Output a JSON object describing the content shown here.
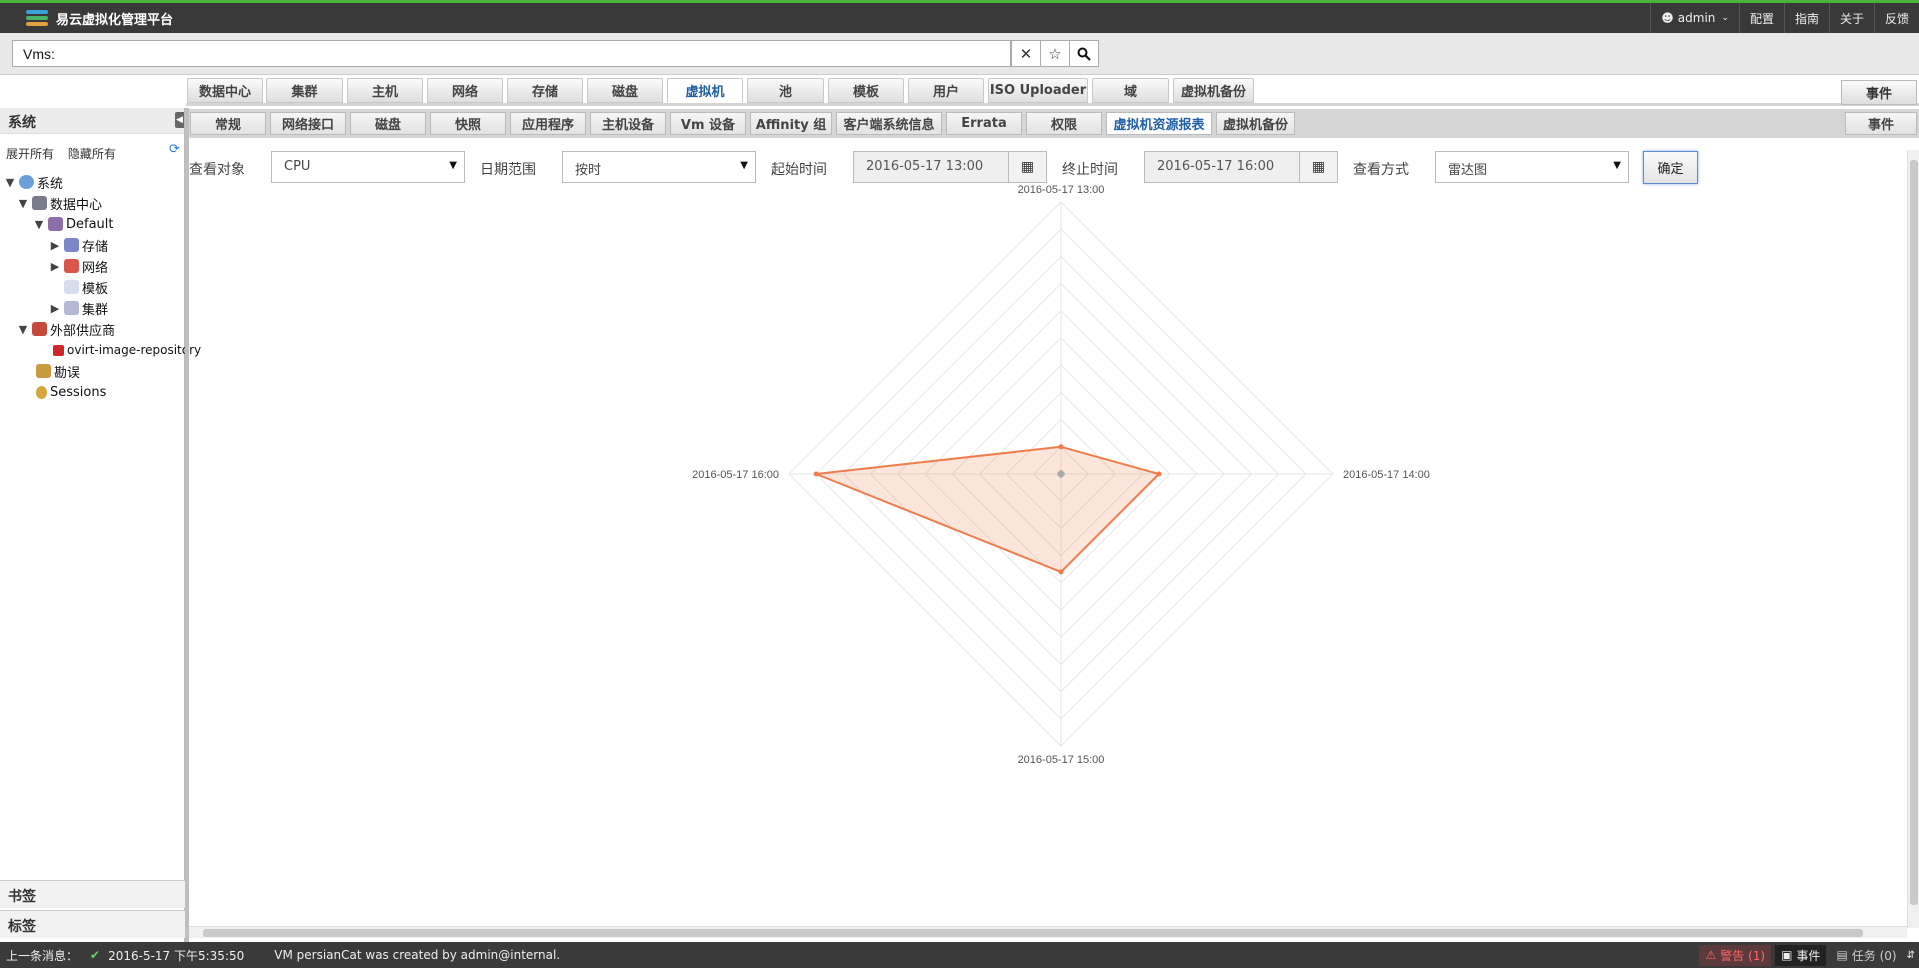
{
  "header": {
    "app_title": "易云虚拟化管理平台",
    "user": "admin",
    "menu": [
      "配置",
      "指南",
      "关于",
      "反馈"
    ]
  },
  "search": {
    "value": "Vms:"
  },
  "main_tabs": [
    "数据中心",
    "集群",
    "主机",
    "网络",
    "存储",
    "磁盘",
    "虚拟机",
    "池",
    "模板",
    "用户",
    "ISO Uploader",
    "域",
    "虚拟机备份"
  ],
  "main_tabs_active": "虚拟机",
  "events_label": "事件",
  "sub_tabs": [
    "常规",
    "网络接口",
    "磁盘",
    "快照",
    "应用程序",
    "主机设备",
    "Vm 设备",
    "Affinity 组",
    "客户端系统信息",
    "Errata",
    "权限",
    "虚拟机资源报表",
    "虚拟机备份"
  ],
  "sub_tabs_active": "虚拟机资源报表",
  "sidebar": {
    "title": "系统",
    "expand_all": "展开所有",
    "collapse_all": "隐藏所有",
    "tree": [
      "系统",
      "数据中心",
      "Default",
      "存储",
      "网络",
      "模板",
      "集群",
      "外部供应商",
      "ovirt-image-repository",
      "勘误",
      "Sessions"
    ],
    "bookmarks": "书签",
    "tags": "标签"
  },
  "filters": {
    "object_label": "查看对象",
    "object_value": "CPU",
    "range_label": "日期范围",
    "range_value": "按时",
    "start_label": "起始时间",
    "start_value": "2016-05-17 13:00",
    "end_label": "终止时间",
    "end_value": "2016-05-17 16:00",
    "view_label": "查看方式",
    "view_value": "雷达图",
    "confirm": "确定"
  },
  "chart_data": {
    "type": "radar",
    "axes": [
      "2016-05-17 13:00",
      "2016-05-17 14:00",
      "2016-05-17 15:00",
      "2016-05-17 16:00"
    ],
    "series": [
      {
        "values": [
          10,
          36,
          36,
          90
        ],
        "color": "#f07c4a"
      },
      {
        "values": [
          0.5,
          0.5,
          0.5,
          0.5
        ],
        "color": "#aaaaaa"
      }
    ],
    "max": 100,
    "levels": 10
  },
  "status": {
    "last_msg_label": "上一条消息：",
    "time": "2016-5-17 下午5:35:50",
    "message": "VM persianCat was created by admin@internal.",
    "alerts": "警告 (1)",
    "events": "事件",
    "tasks": "任务 (0)"
  }
}
